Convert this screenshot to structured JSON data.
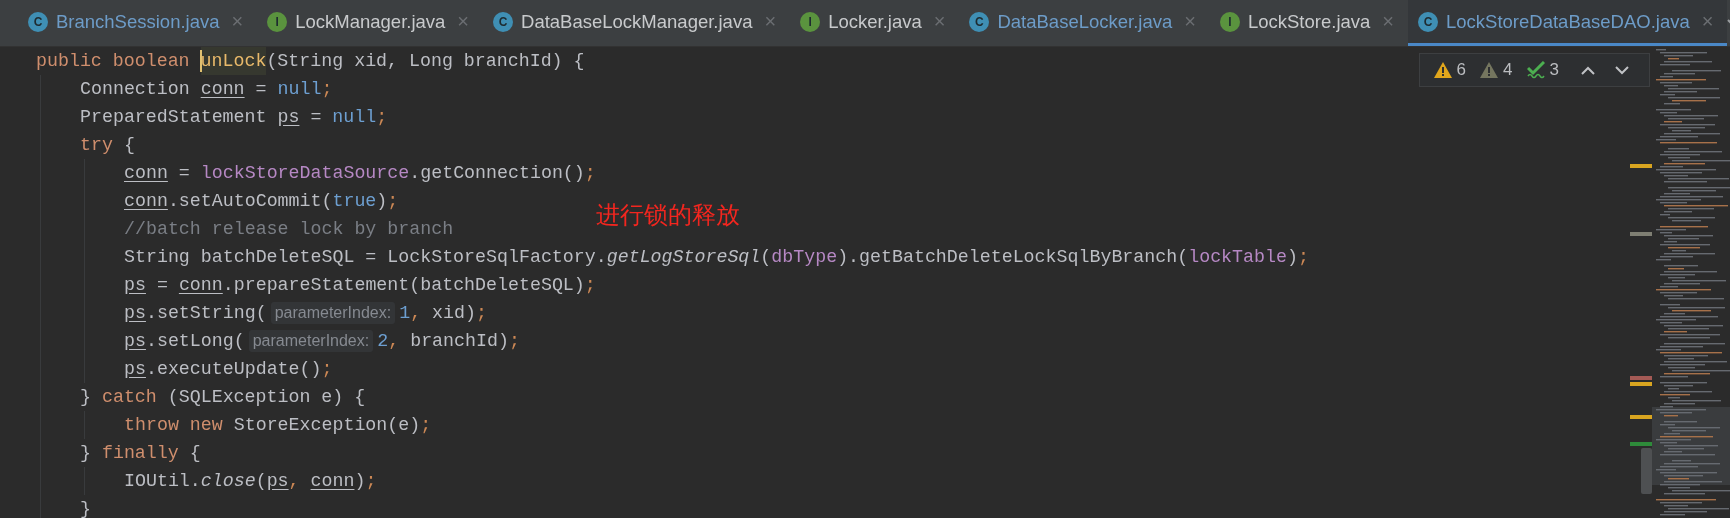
{
  "tabs": [
    {
      "icon": "C",
      "kind": "class",
      "label": "BranchSession.java",
      "modified": true,
      "selected": false,
      "close": "×"
    },
    {
      "icon": "I",
      "kind": "interface",
      "label": "LockManager.java",
      "modified": false,
      "selected": false,
      "close": "×"
    },
    {
      "icon": "C",
      "kind": "class",
      "label": "DataBaseLockManager.java",
      "modified": false,
      "selected": false,
      "close": "×"
    },
    {
      "icon": "I",
      "kind": "interface",
      "label": "Locker.java",
      "modified": false,
      "selected": false,
      "close": "×"
    },
    {
      "icon": "C",
      "kind": "class",
      "label": "DataBaseLocker.java",
      "modified": true,
      "selected": false,
      "close": "×"
    },
    {
      "icon": "I",
      "kind": "interface",
      "label": "LockStore.java",
      "modified": false,
      "selected": false,
      "close": "×"
    },
    {
      "icon": "C",
      "kind": "class",
      "label": "LockStoreDataBaseDAO.java",
      "modified": true,
      "selected": true,
      "close": "×"
    }
  ],
  "inspections": [
    {
      "kind": "warning",
      "count": "6"
    },
    {
      "kind": "weak-warning",
      "count": "4"
    },
    {
      "kind": "typo",
      "count": "3"
    }
  ],
  "code": [
    {
      "tokens": [
        {
          "kind": "keyword",
          "text": "public boolean "
        },
        {
          "kind": "method-decl",
          "text": "unLock",
          "caret": true
        },
        {
          "kind": "plain",
          "text": "(String xid, Long branchId) {"
        }
      ],
      "children": [
        {
          "tokens": [
            {
              "kind": "plain",
              "text": "Connection "
            },
            {
              "kind": "var",
              "text": "conn"
            },
            {
              "kind": "plain",
              "text": " = "
            },
            {
              "kind": "literal",
              "text": "null"
            },
            {
              "kind": "punct",
              "text": ";"
            }
          ]
        },
        {
          "tokens": [
            {
              "kind": "plain",
              "text": "PreparedStatement "
            },
            {
              "kind": "var",
              "text": "ps"
            },
            {
              "kind": "plain",
              "text": " = "
            },
            {
              "kind": "literal",
              "text": "null"
            },
            {
              "kind": "punct",
              "text": ";"
            }
          ]
        },
        {
          "tokens": [
            {
              "kind": "keyword",
              "text": "try"
            },
            {
              "kind": "plain",
              "text": " {"
            }
          ],
          "children": [
            {
              "tokens": [
                {
                  "kind": "var",
                  "text": "conn"
                },
                {
                  "kind": "plain",
                  "text": " = "
                },
                {
                  "kind": "field",
                  "text": "lockStoreDataSource"
                },
                {
                  "kind": "plain",
                  "text": ".getConnection()"
                },
                {
                  "kind": "punct",
                  "text": ";"
                }
              ]
            },
            {
              "tokens": [
                {
                  "kind": "var",
                  "text": "conn"
                },
                {
                  "kind": "plain",
                  "text": ".setAutoCommit("
                },
                {
                  "kind": "literal",
                  "text": "true"
                },
                {
                  "kind": "plain",
                  "text": ")"
                },
                {
                  "kind": "punct",
                  "text": ";"
                }
              ]
            },
            {
              "tokens": [
                {
                  "kind": "comment",
                  "text": "//batch release lock by branch"
                }
              ]
            },
            {
              "tokens": [
                {
                  "kind": "plain",
                  "text": "String batchDeleteSQL = LockStoreSqlFactory."
                },
                {
                  "kind": "static",
                  "text": "getLogStoreSql"
                },
                {
                  "kind": "plain",
                  "text": "("
                },
                {
                  "kind": "field",
                  "text": "dbType"
                },
                {
                  "kind": "plain",
                  "text": ").getBatchDeleteLockSqlByBranch("
                },
                {
                  "kind": "field",
                  "text": "lockTable"
                },
                {
                  "kind": "plain",
                  "text": ")"
                },
                {
                  "kind": "punct",
                  "text": ";"
                }
              ]
            },
            {
              "tokens": [
                {
                  "kind": "var",
                  "text": "ps"
                },
                {
                  "kind": "plain",
                  "text": " = "
                },
                {
                  "kind": "var",
                  "text": "conn"
                },
                {
                  "kind": "plain",
                  "text": ".prepareStatement(batchDeleteSQL)"
                },
                {
                  "kind": "punct",
                  "text": ";"
                }
              ]
            },
            {
              "tokens": [
                {
                  "kind": "var",
                  "text": "ps"
                },
                {
                  "kind": "plain",
                  "text": ".setString("
                },
                {
                  "kind": "hint",
                  "text": "parameterIndex:"
                },
                {
                  "kind": "literal",
                  "text": "1"
                },
                {
                  "kind": "punct",
                  "text": ","
                },
                {
                  "kind": "plain",
                  "text": " xid)"
                },
                {
                  "kind": "punct",
                  "text": ";"
                }
              ]
            },
            {
              "tokens": [
                {
                  "kind": "var",
                  "text": "ps"
                },
                {
                  "kind": "plain",
                  "text": ".setLong("
                },
                {
                  "kind": "hint",
                  "text": "parameterIndex:"
                },
                {
                  "kind": "literal",
                  "text": "2"
                },
                {
                  "kind": "punct",
                  "text": ","
                },
                {
                  "kind": "plain",
                  "text": " branchId)"
                },
                {
                  "kind": "punct",
                  "text": ";"
                }
              ]
            },
            {
              "tokens": [
                {
                  "kind": "var",
                  "text": "ps"
                },
                {
                  "kind": "plain",
                  "text": ".executeUpdate()"
                },
                {
                  "kind": "punct",
                  "text": ";"
                }
              ]
            }
          ]
        },
        {
          "tokens": [
            {
              "kind": "plain",
              "text": "} "
            },
            {
              "kind": "keyword",
              "text": "catch"
            },
            {
              "kind": "plain",
              "text": " (SQLException e) {"
            }
          ],
          "children": [
            {
              "tokens": [
                {
                  "kind": "keyword",
                  "text": "throw new "
                },
                {
                  "kind": "plain",
                  "text": "StoreException(e)"
                },
                {
                  "kind": "punct",
                  "text": ";"
                }
              ]
            }
          ]
        },
        {
          "tokens": [
            {
              "kind": "plain",
              "text": "} "
            },
            {
              "kind": "keyword",
              "text": "finally"
            },
            {
              "kind": "plain",
              "text": " {"
            }
          ],
          "children": [
            {
              "tokens": [
                {
                  "kind": "plain",
                  "text": "IOUtil."
                },
                {
                  "kind": "static",
                  "text": "close"
                },
                {
                  "kind": "plain",
                  "text": "("
                },
                {
                  "kind": "var",
                  "text": "ps"
                },
                {
                  "kind": "punct",
                  "text": ", "
                },
                {
                  "kind": "var",
                  "text": "conn"
                },
                {
                  "kind": "plain",
                  "text": ")"
                },
                {
                  "kind": "punct",
                  "text": ";"
                }
              ]
            }
          ]
        },
        {
          "tokens": [
            {
              "kind": "plain",
              "text": "}"
            }
          ]
        }
      ]
    }
  ],
  "annotation": "进行锁的释放"
}
